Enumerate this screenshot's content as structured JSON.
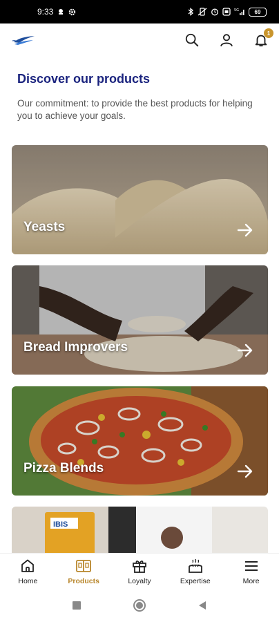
{
  "status_bar": {
    "time": "9:33",
    "battery": "69"
  },
  "header": {
    "logo_icon": "ibis-bird-logo-icon",
    "notification_count": "1",
    "colors": {
      "accent": "#c9952c"
    }
  },
  "main": {
    "title": "Discover our products",
    "description": "Our commitment: to provide the best products for helping you to achieve your goals.",
    "products": [
      {
        "label": "Yeasts",
        "icon": "arrow-right-icon"
      },
      {
        "label": "Bread Improvers",
        "icon": "arrow-right-icon"
      },
      {
        "label": "Pizza Blends",
        "icon": "arrow-right-icon"
      },
      {
        "label": "",
        "icon": "arrow-right-icon"
      }
    ],
    "colors": {
      "title": "#1a237e"
    }
  },
  "bottom_nav": {
    "items": [
      {
        "label": "Home",
        "icon": "home-icon",
        "active": false
      },
      {
        "label": "Products",
        "icon": "products-book-icon",
        "active": true
      },
      {
        "label": "Loyalty",
        "icon": "gift-icon",
        "active": false
      },
      {
        "label": "Expertise",
        "icon": "bakery-expertise-icon",
        "active": false
      },
      {
        "label": "More",
        "icon": "hamburger-menu-icon",
        "active": false
      }
    ],
    "colors": {
      "active": "#b8862b"
    }
  }
}
